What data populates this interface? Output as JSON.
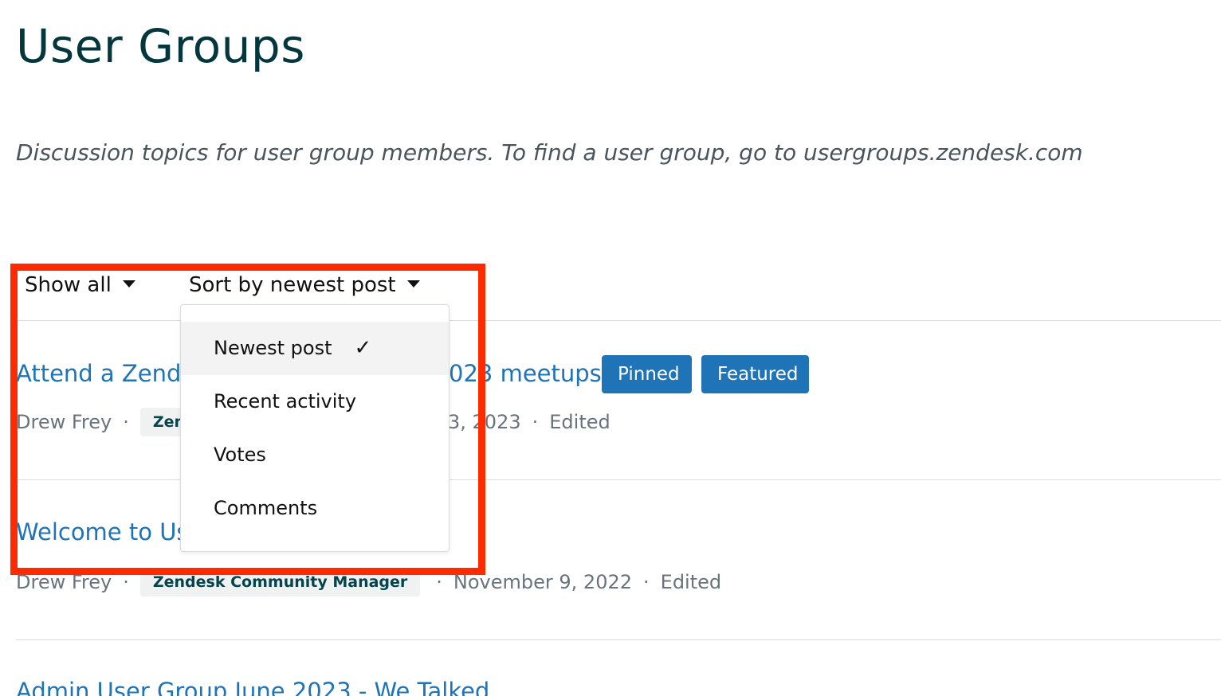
{
  "page": {
    "title": "User Groups",
    "description": "Discussion topics for user group members. To find a user group, go to usergroups.zendesk.com"
  },
  "filters": {
    "show_all_label": "Show all",
    "sort_label": "Sort by newest post"
  },
  "sort_dropdown": {
    "items": [
      {
        "label": "Newest post",
        "selected_mark": "✓"
      },
      {
        "label": "Recent activity"
      },
      {
        "label": "Votes"
      },
      {
        "label": "Comments"
      }
    ]
  },
  "posts": [
    {
      "title_left": "Attend a Zende",
      "title_right": "023 meetups",
      "badges": [
        "Pinned",
        "Featured"
      ],
      "author": "Drew Frey",
      "tag": "Zen",
      "date": "3, 2023",
      "edited": "Edited"
    },
    {
      "title_left": "Welcome to Us",
      "author": "Drew Frey",
      "tag": "Zendesk Community Manager",
      "date": "November 9, 2022",
      "edited": "Edited"
    },
    {
      "title_left": "Admin User Group June 2023 - We Talked"
    }
  ],
  "colors": {
    "title": "#03363d",
    "link": "#1f73b7",
    "badge": "#1f73b7",
    "highlight": "#ff2a00"
  },
  "meta_separator": "·"
}
